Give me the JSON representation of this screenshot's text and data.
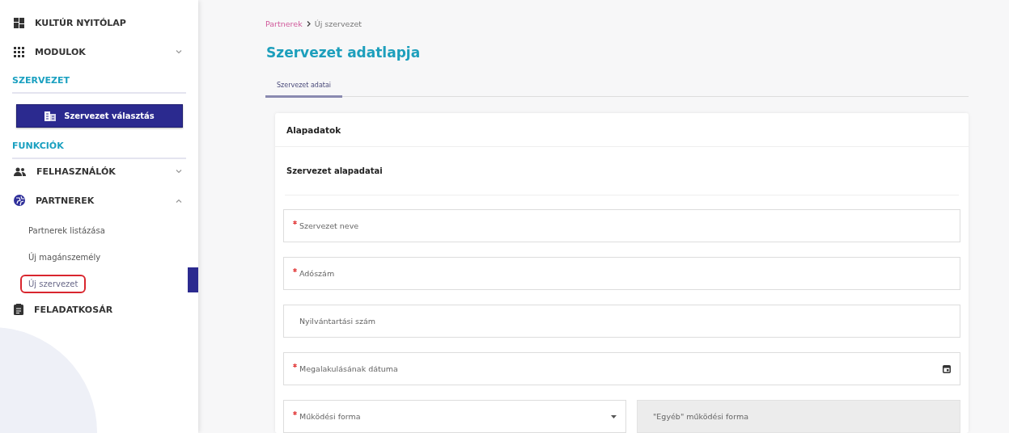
{
  "sidebar": {
    "items": [
      {
        "kind": "link",
        "label": "KULTÚR NYITÓLAP"
      },
      {
        "kind": "group",
        "label": "MODULOK",
        "expanded": false
      },
      {
        "kind": "heading",
        "label": "SZERVEZET"
      },
      {
        "kind": "button",
        "label": "Szervezet választás"
      },
      {
        "kind": "heading",
        "label": "FUNKCIÓK"
      },
      {
        "kind": "group",
        "label": "FELHASZNÁLÓK",
        "expanded": false
      },
      {
        "kind": "group",
        "label": "PARTNEREK",
        "expanded": true,
        "children": [
          {
            "label": "Partnerek listázása",
            "selected": false
          },
          {
            "label": "Új magánszemély",
            "selected": false
          },
          {
            "label": "Új szervezet",
            "selected": true
          }
        ]
      },
      {
        "kind": "link",
        "label": "FELADATKOSÁR"
      }
    ]
  },
  "breadcrumb": [
    {
      "label": "Partnerek",
      "kind": "link"
    },
    {
      "label": "Új szervezet",
      "kind": "current"
    }
  ],
  "title": "Szervezet adatlapja",
  "tabs": [
    {
      "label": "Szervezet adatai",
      "selected": true
    }
  ],
  "card": {
    "header": "Alapadatok",
    "section": "Szervezet alapadatai",
    "rows": [
      [
        {
          "kind": "text",
          "placeholder": "Szervezet neve",
          "required": true
        }
      ],
      [
        {
          "kind": "text",
          "placeholder": "Adószám",
          "required": true
        }
      ],
      [
        {
          "kind": "text",
          "placeholder": "Nyilvántartási szám",
          "required": false
        }
      ],
      [
        {
          "kind": "date",
          "placeholder": "Megalakulásának dátuma",
          "required": true
        }
      ],
      [
        {
          "kind": "select",
          "placeholder": "Működési forma",
          "required": true
        },
        {
          "kind": "text",
          "placeholder": "\"Egyéb\" működési forma",
          "required": false,
          "disabled": true
        }
      ]
    ]
  }
}
